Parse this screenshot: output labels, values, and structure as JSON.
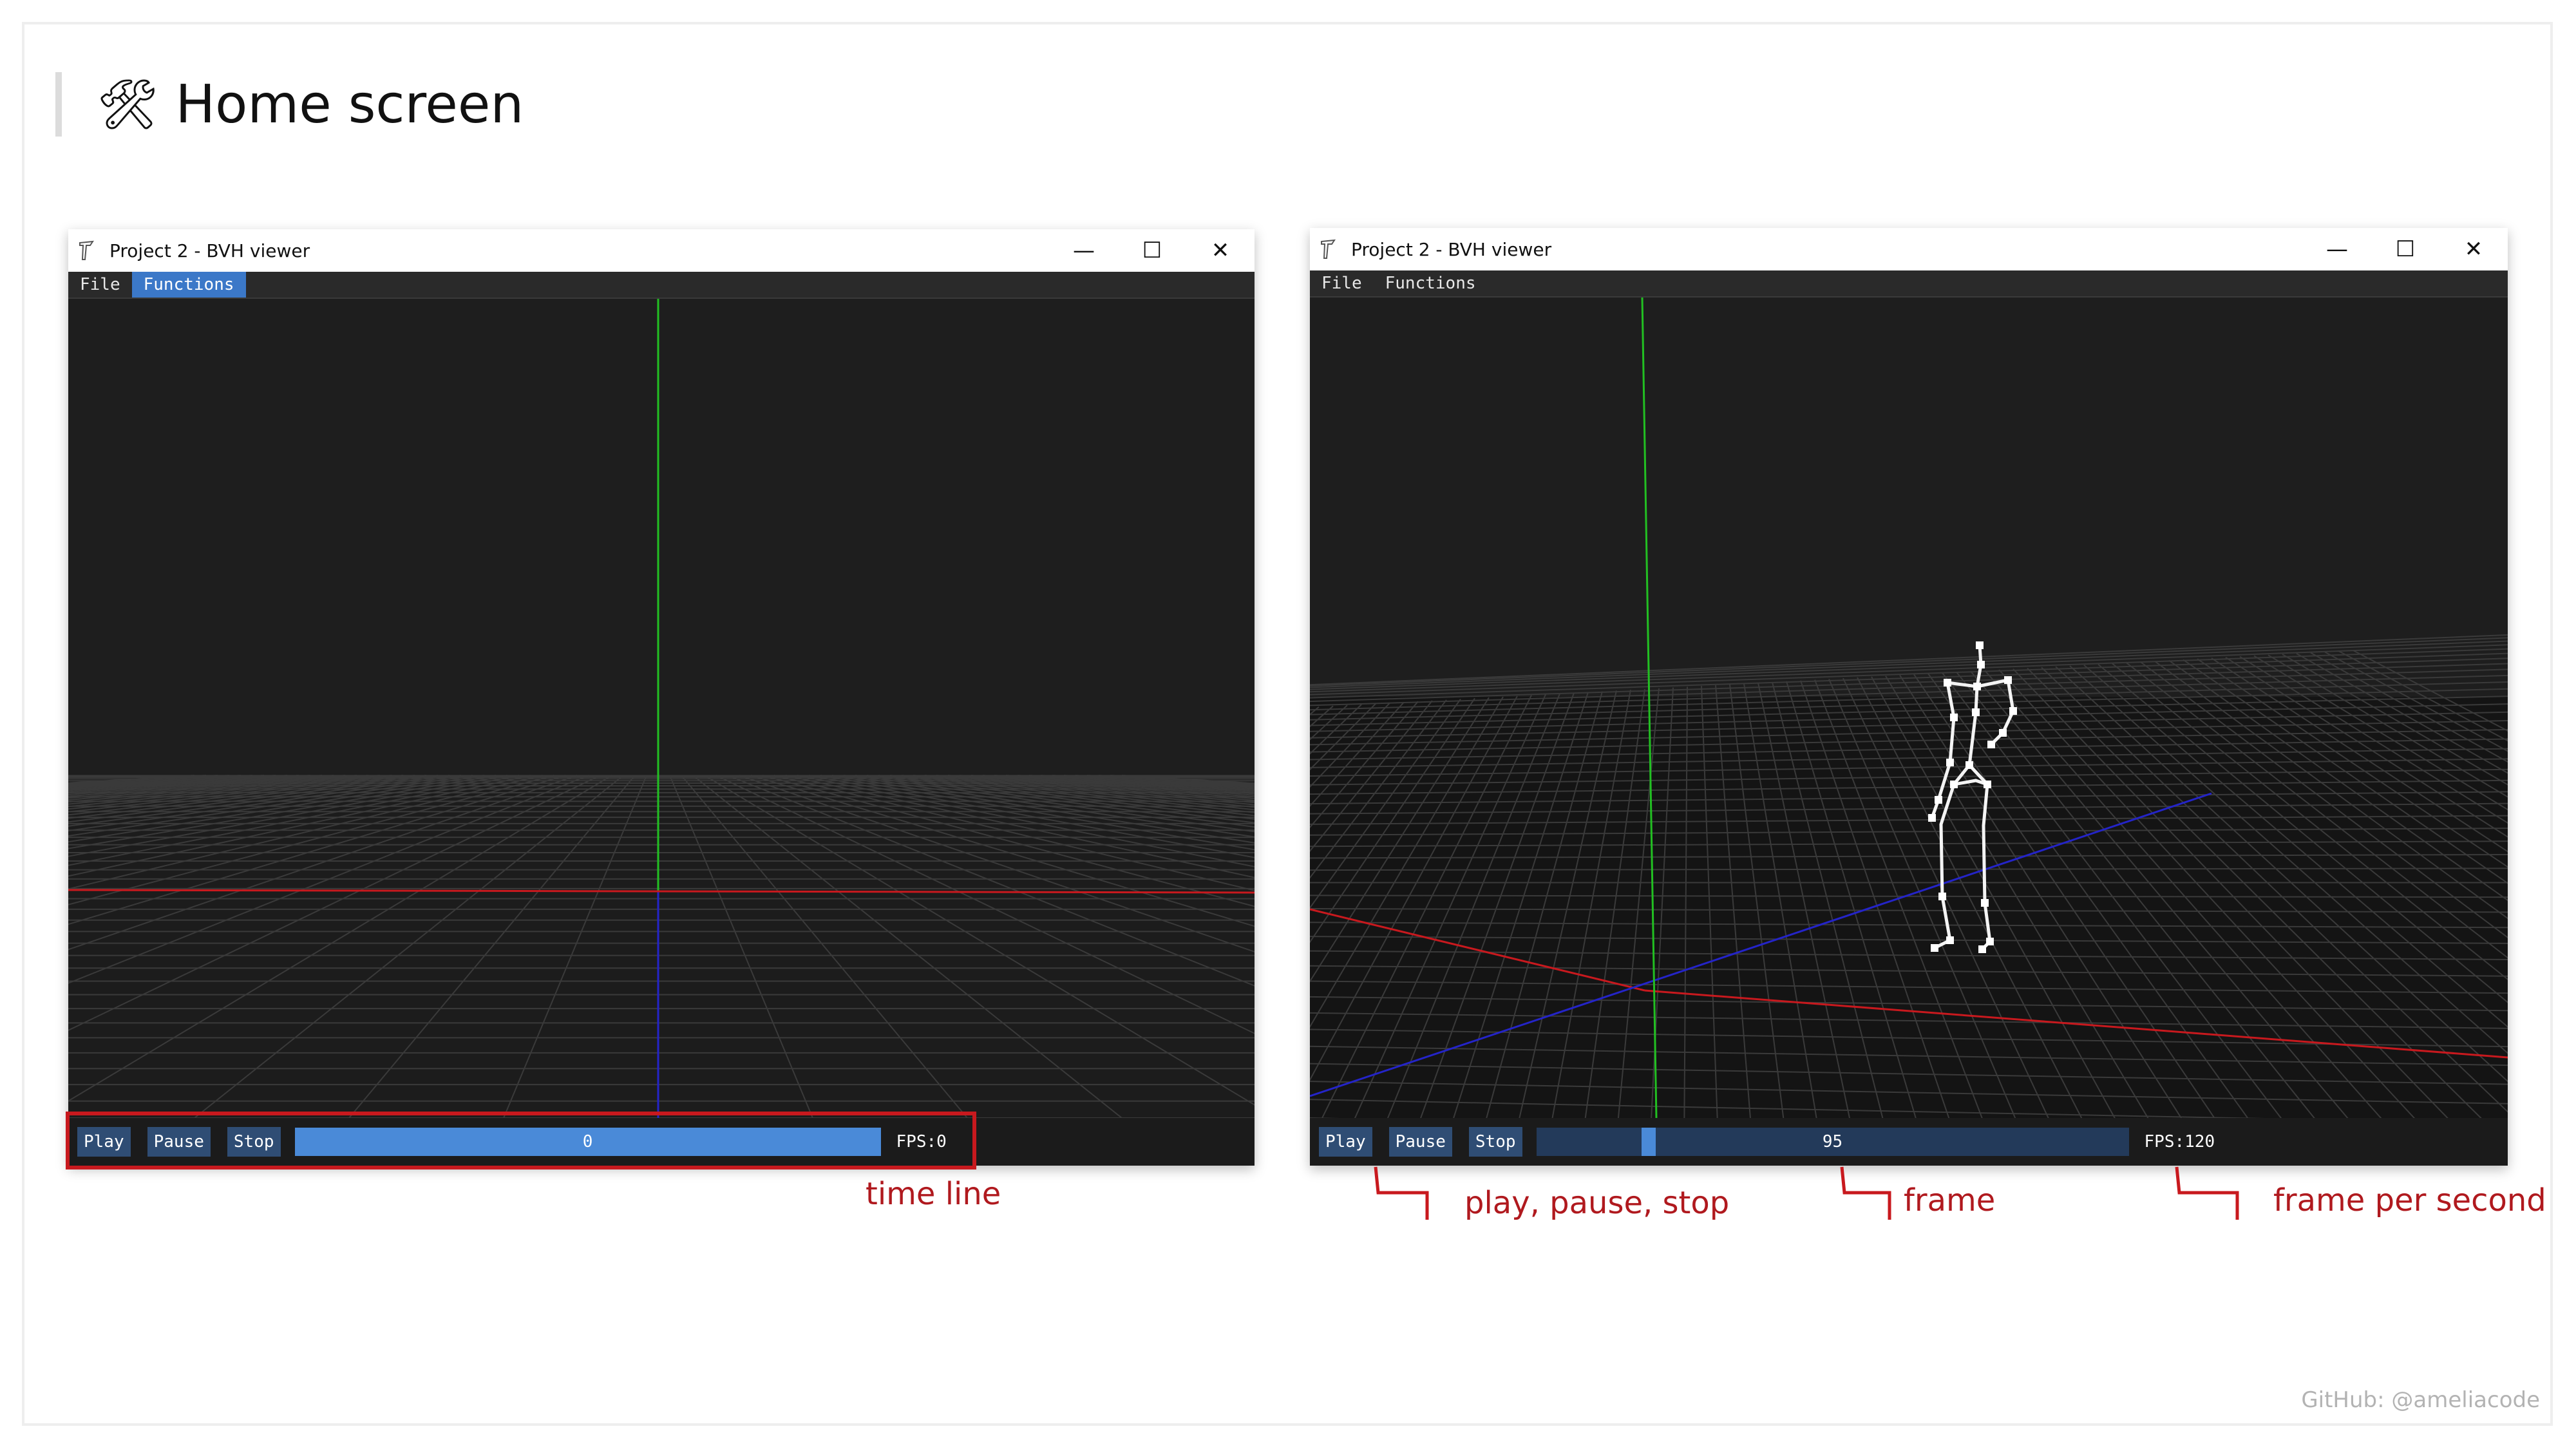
{
  "slide": {
    "title_icon": "hammer-and-wrench-icon",
    "title_glyph": "🛠",
    "title": "Home screen",
    "footer": "GitHub: @ameliacode"
  },
  "windows": [
    {
      "title": "Project 2 - BVH viewer",
      "controls": [
        "—",
        "☐",
        "✕"
      ],
      "menu": [
        {
          "label": "File",
          "active": false
        },
        {
          "label": "Functions",
          "active": true
        }
      ],
      "buttons": [
        "Play",
        "Pause",
        "Stop"
      ],
      "timeline_value": "0",
      "timeline_progress": 1.0,
      "fps": "FPS:0"
    },
    {
      "title": "Project 2 - BVH viewer",
      "controls": [
        "—",
        "☐",
        "✕"
      ],
      "menu": [
        {
          "label": "File",
          "active": false
        },
        {
          "label": "Functions",
          "active": false
        }
      ],
      "buttons": [
        "Play",
        "Pause",
        "Stop"
      ],
      "timeline_value": "95",
      "timeline_progress": 0.19,
      "fps": "FPS:120"
    }
  ],
  "annotations": {
    "time_line": "time line",
    "play_pause_stop": "play, pause, stop",
    "frame": "frame",
    "fps": "frame per second"
  },
  "colors": {
    "annotation": "#c8191e",
    "button": "#2f4d74",
    "timeline_fill": "#4a8ad8",
    "x_axis": "#c8191e",
    "y_axis": "#22c022",
    "z_axis": "#2424c8"
  }
}
